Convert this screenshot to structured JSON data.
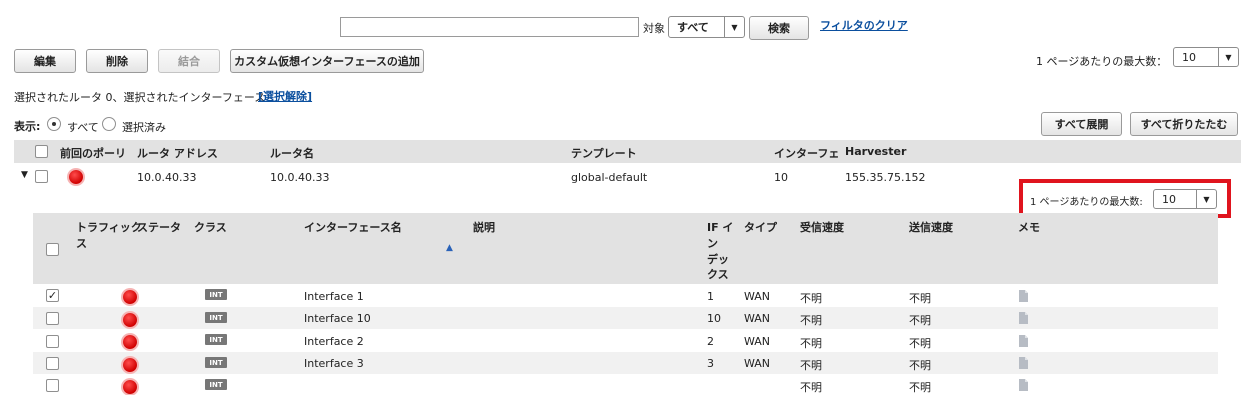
{
  "filter": {
    "search_value": "",
    "target_label": "対象",
    "target_select": "すべて",
    "search_button": "検索",
    "clear_link": "フィルタのクリア"
  },
  "toolbar": {
    "edit": "編集",
    "delete": "削除",
    "merge": "結合",
    "add_custom_vif": "カスタム仮想インターフェースの追加",
    "per_page_label": "1 ページあたりの最大数：",
    "per_page_value": "10"
  },
  "selection": {
    "text": "選択されたルータ 0、選択されたインターフェース",
    "clear_link": "[選択解除]"
  },
  "view": {
    "label": "表示:",
    "option_all": "すべて",
    "option_selected": "選択済み",
    "expand_all": "すべて展開",
    "collapse_all": "すべて折りたたむ"
  },
  "router_table": {
    "headers": [
      "前回のポーリ",
      "ルータ アドレス",
      "ルータ名",
      "テンプレート",
      "インターフェ",
      "Harvester"
    ],
    "row": {
      "address": "10.0.40.33",
      "name": "10.0.40.33",
      "template": "global-default",
      "interfaces": "10",
      "harvester": "155.35.75.152"
    }
  },
  "sub_table": {
    "per_page_label": "1 ページあたりの最大数:",
    "per_page_value": "10",
    "headers": {
      "traffic_line1": "トラフィック",
      "traffic_line2": "ス",
      "status": "ステータ",
      "class": "クラス",
      "if_name": "インターフェース名",
      "description": "説明",
      "ifindex_lines": [
        "IF イ",
        "ン",
        "デッ",
        "クス"
      ],
      "type": "タイプ",
      "rx_speed": "受信速度",
      "tx_speed": "送信速度",
      "memo": "メモ"
    },
    "rows": [
      {
        "checked": "✓",
        "class": "INT",
        "name": "Interface 1",
        "index": "1",
        "type": "WAN",
        "rx": "不明",
        "tx": "不明"
      },
      {
        "checked": "",
        "class": "INT",
        "name": "Interface 10",
        "index": "10",
        "type": "WAN",
        "rx": "不明",
        "tx": "不明"
      },
      {
        "checked": "",
        "class": "INT",
        "name": "Interface 2",
        "index": "2",
        "type": "WAN",
        "rx": "不明",
        "tx": "不明"
      },
      {
        "checked": "",
        "class": "INT",
        "name": "Interface 3",
        "index": "3",
        "type": "WAN",
        "rx": "不明",
        "tx": "不明"
      },
      {
        "checked": "",
        "class": "INT",
        "name": "",
        "index": "",
        "type": "",
        "rx": "不明",
        "tx": "不明"
      }
    ]
  },
  "colors": {
    "highlight_border": "#e0141e",
    "status_red": "#d00000",
    "header_band": "#e2e2e2",
    "link": "#0b4f9e"
  }
}
